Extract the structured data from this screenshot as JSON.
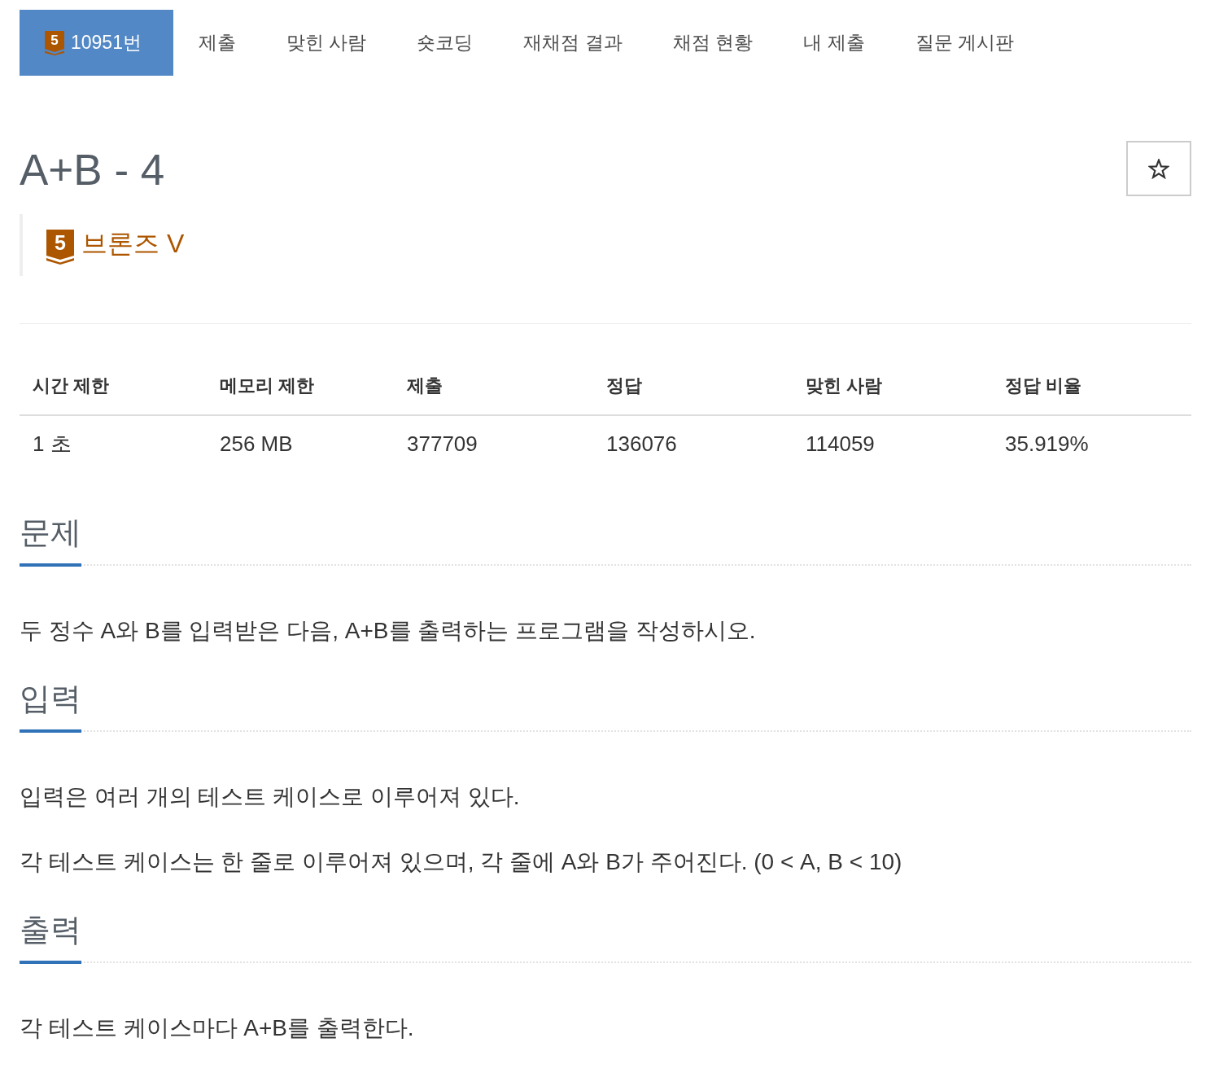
{
  "tabs": [
    {
      "label": "10951번",
      "selected": true,
      "badge": "5"
    },
    {
      "label": "제출",
      "selected": false
    },
    {
      "label": "맞힌 사람",
      "selected": false
    },
    {
      "label": "숏코딩",
      "selected": false
    },
    {
      "label": "재채점 결과",
      "selected": false
    },
    {
      "label": "채점 현황",
      "selected": false
    },
    {
      "label": "내 제출",
      "selected": false
    },
    {
      "label": "질문 게시판",
      "selected": false
    }
  ],
  "problem": {
    "title": "A+B - 4",
    "starred": false,
    "tier": {
      "badge": "5",
      "name": "브론즈 V"
    }
  },
  "info_table": {
    "columns": [
      "시간 제한",
      "메모리 제한",
      "제출",
      "정답",
      "맞힌 사람",
      "정답 비율"
    ],
    "rows": [
      [
        "1 초",
        "256 MB",
        "377709",
        "136076",
        "114059",
        "35.919%"
      ]
    ]
  },
  "sections": [
    {
      "heading": "문제",
      "paragraphs": [
        "두 정수 A와 B를 입력받은 다음, A+B를 출력하는 프로그램을 작성하시오."
      ]
    },
    {
      "heading": "입력",
      "paragraphs": [
        "입력은 여러 개의 테스트 케이스로 이루어져 있다.",
        "각 테스트 케이스는 한 줄로 이루어져 있으며, 각 줄에 A와 B가 주어진다. (0 < A, B < 10)"
      ]
    },
    {
      "heading": "출력",
      "paragraphs": [
        "각 테스트 케이스마다 A+B를 출력한다."
      ]
    }
  ]
}
